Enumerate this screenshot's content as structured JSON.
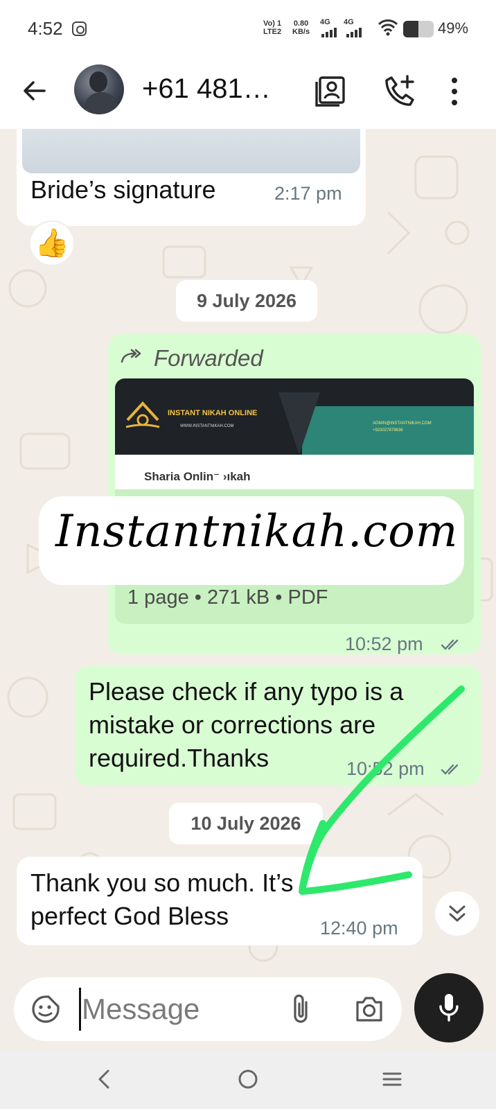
{
  "status_bar": {
    "time": "4:52",
    "volte": "Vo) 1",
    "lte": "LTE2",
    "speed_value": "0.80",
    "speed_unit": "KB/s",
    "net1": "4G",
    "net2": "4G",
    "battery_text": "49%",
    "battery_level": 0.49
  },
  "header": {
    "contact_name": "+61 481…"
  },
  "messages": {
    "first": {
      "text": "Bride’s signature",
      "time": "2:17 pm",
      "reaction": "👍"
    },
    "date1": "9 July 2026",
    "forwarded": {
      "label": "Forwarded",
      "doc_banner_title": "INSTANT NIKAH ONLINE",
      "doc_banner_url": "WWW.INSTANTNIKAH.COM",
      "doc_banner_email": "ADMIN@INSTANTNIKAH.COM",
      "doc_banner_phone": "+923027879636",
      "doc_subtitle": "Sharia Onlin⁻ ›ıkah",
      "meta": "1 page • 271 kB • PDF",
      "time": "10:52 pm"
    },
    "second": {
      "text": "Please check if any typo is a mistake or corrections are required.Thanks",
      "time": "10:52 pm"
    },
    "date2": "10 July 2026",
    "third": {
      "text": "Thank you so much. It’s perfect God Bless",
      "time": "12:40 pm"
    }
  },
  "overlay": {
    "text": "Instantnikah.com"
  },
  "composer": {
    "placeholder": "Message"
  },
  "colors": {
    "incoming_bubble": "#ffffff",
    "outgoing_bubble": "#d9fdd3",
    "chat_background": "#f2ede6",
    "annotation_arrow": "#2ee86c",
    "read_ticks": "#667781"
  },
  "icons": {
    "back": "arrow-left-icon",
    "contact_card": "contact-card-icon",
    "add_call": "phone-plus-icon",
    "more": "more-vertical-icon",
    "forwarded": "forward-icon",
    "scroll_down": "double-chevron-down-icon",
    "emoji": "sticker-emoji-icon",
    "attach": "paperclip-icon",
    "camera": "camera-icon",
    "mic": "microphone-icon"
  }
}
